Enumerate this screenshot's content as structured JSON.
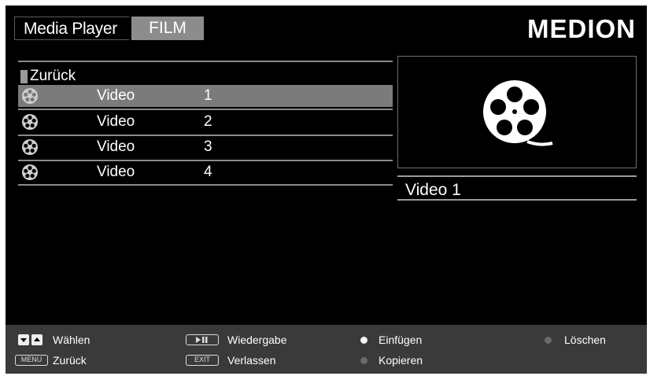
{
  "header": {
    "app_title": "Media Player",
    "active_tab": "FILM",
    "brand": "MEDION"
  },
  "filelist": {
    "back_label": "Zurück",
    "items": [
      {
        "name": "Video",
        "number": "1",
        "selected": true
      },
      {
        "name": "Video",
        "number": "2",
        "selected": false
      },
      {
        "name": "Video",
        "number": "3",
        "selected": false
      },
      {
        "name": "Video",
        "number": "4",
        "selected": false
      }
    ]
  },
  "preview": {
    "icon": "film-reel-icon",
    "title": "Video 1"
  },
  "footer": {
    "select_label": "Wählen",
    "back_key": "MENU",
    "back_label": "Zurück",
    "play_label": "Wiedergabe",
    "exit_key": "EXIT",
    "exit_label": "Verlassen",
    "insert_label": "Einfügen",
    "copy_label": "Kopieren",
    "delete_label": "Löschen"
  },
  "colors": {
    "background": "#000000",
    "selected_row": "#7b7b7b",
    "footer_bg": "#3a3a3a",
    "tab_bg": "#8c8c8c"
  }
}
